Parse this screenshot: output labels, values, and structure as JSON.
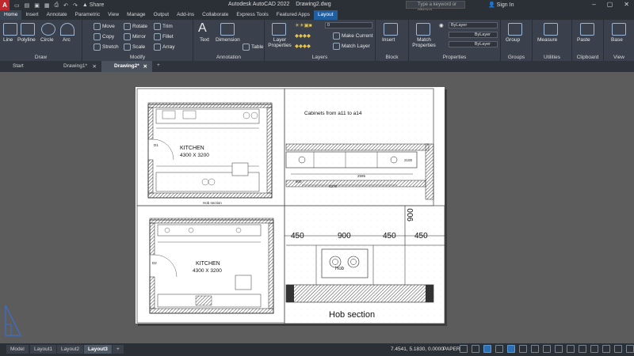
{
  "titlebar": {
    "logo": "A",
    "share": "Share",
    "title": "Autodesk AutoCAD 2022",
    "filename": "Drawing2.dwg",
    "search_placeholder": "Type a keyword or phrase",
    "signin": "Sign In"
  },
  "menu_tabs": [
    "Home",
    "Insert",
    "Annotate",
    "Parametric",
    "View",
    "Manage",
    "Output",
    "Add-ins",
    "Collaborate",
    "Express Tools",
    "Featured Apps",
    "Layout"
  ],
  "ribbon": {
    "draw": {
      "title": "Draw",
      "line": "Line",
      "polyline": "Polyline",
      "circle": "Circle",
      "arc": "Arc"
    },
    "modify": {
      "title": "Modify",
      "move": "Move",
      "rotate": "Rotate",
      "trim": "Trim",
      "copy": "Copy",
      "mirror": "Mirror",
      "fillet": "Fillet",
      "stretch": "Stretch",
      "scale": "Scale",
      "array": "Array"
    },
    "annotation": {
      "title": "Annotation",
      "text": "Text",
      "dimension": "Dimension",
      "table": "Table"
    },
    "layers": {
      "title": "Layers",
      "layer_properties": "Layer Properties",
      "current_layer": "0",
      "make_current": "Make Current",
      "match_layer": "Match Layer"
    },
    "block": {
      "title": "Block",
      "insert": "Insert"
    },
    "properties": {
      "title": "Properties",
      "match_properties": "Match Properties",
      "color": "ByLayer",
      "linetype": "ByLayer",
      "lineweight": "ByLayer"
    },
    "groups": {
      "title": "Groups",
      "group": "Group"
    },
    "utilities": {
      "title": "Utilities",
      "measure": "Measure"
    },
    "clipboard": {
      "title": "Clipboard",
      "paste": "Paste"
    },
    "view": {
      "title": "View",
      "base": "Base"
    }
  },
  "doc_tabs": [
    {
      "label": "Start",
      "closable": false
    },
    {
      "label": "Drawing1*",
      "closable": true
    },
    {
      "label": "Drawing2*",
      "closable": true,
      "active": true
    }
  ],
  "drawing": {
    "kitchen_title": "KITCHEN",
    "kitchen_size": "4300 X 3200",
    "door_1": "D1",
    "door_2": "D2",
    "hob_section_small": "Hob section",
    "cabinets_note": "Cabinets from a11 to a14",
    "dims_top": [
      "2595",
      "600",
      "4270",
      "2100"
    ],
    "dims_hob": [
      "450",
      "900",
      "450",
      "450",
      "900"
    ],
    "hob_label": "Hob",
    "hob_section_title": "Hob section"
  },
  "status": {
    "layout_tabs": [
      "Model",
      "Layout1",
      "Layout2",
      "Layout3"
    ],
    "active_layout": "Layout3",
    "coords": "7.4541, 5.1830, 0.0000",
    "space": "PAPER"
  },
  "colors": {
    "titlebar_bg": "#2b2f36",
    "ribbon_bg": "#3a414c",
    "canvas_bg": "#5c5c5c",
    "accent": "#1f5f9f",
    "hatch": "#444444"
  }
}
